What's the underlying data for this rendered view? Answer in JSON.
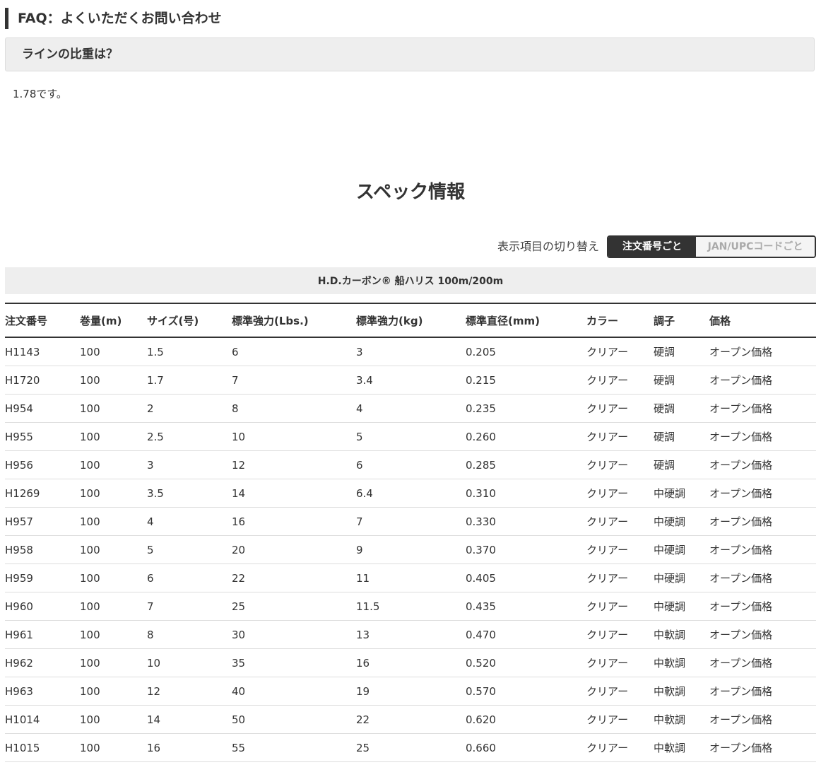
{
  "faq": {
    "heading": "FAQ：よくいただくお問い合わせ",
    "question": "ラインの比重は？",
    "answer": "1.78です。"
  },
  "spec": {
    "title": "スペック情報",
    "toggle_label": "表示項目の切り替え",
    "toggle_options": [
      "注文番号ごと",
      "JAN/UPCコードごと"
    ],
    "toggle_selected": "注文番号ごと",
    "product_name": "H.D.カーボン® 船ハリス 100m/200m",
    "columns": [
      "注文番号",
      "巻量(m)",
      "サイズ(号)",
      "標準強力(Lbs.)",
      "標準強力(kg)",
      "標準直径(mm)",
      "カラー",
      "調子",
      "価格"
    ],
    "rows": [
      [
        "H1143",
        "100",
        "1.5",
        "6",
        "3",
        "0.205",
        "クリアー",
        "硬調",
        "オープン価格"
      ],
      [
        "H1720",
        "100",
        "1.7",
        "7",
        "3.4",
        "0.215",
        "クリアー",
        "硬調",
        "オープン価格"
      ],
      [
        "H954",
        "100",
        "2",
        "8",
        "4",
        "0.235",
        "クリアー",
        "硬調",
        "オープン価格"
      ],
      [
        "H955",
        "100",
        "2.5",
        "10",
        "5",
        "0.260",
        "クリアー",
        "硬調",
        "オープン価格"
      ],
      [
        "H956",
        "100",
        "3",
        "12",
        "6",
        "0.285",
        "クリアー",
        "硬調",
        "オープン価格"
      ],
      [
        "H1269",
        "100",
        "3.5",
        "14",
        "6.4",
        "0.310",
        "クリアー",
        "中硬調",
        "オープン価格"
      ],
      [
        "H957",
        "100",
        "4",
        "16",
        "7",
        "0.330",
        "クリアー",
        "中硬調",
        "オープン価格"
      ],
      [
        "H958",
        "100",
        "5",
        "20",
        "9",
        "0.370",
        "クリアー",
        "中硬調",
        "オープン価格"
      ],
      [
        "H959",
        "100",
        "6",
        "22",
        "11",
        "0.405",
        "クリアー",
        "中硬調",
        "オープン価格"
      ],
      [
        "H960",
        "100",
        "7",
        "25",
        "11.5",
        "0.435",
        "クリアー",
        "中硬調",
        "オープン価格"
      ],
      [
        "H961",
        "100",
        "8",
        "30",
        "13",
        "0.470",
        "クリアー",
        "中軟調",
        "オープン価格"
      ],
      [
        "H962",
        "100",
        "10",
        "35",
        "16",
        "0.520",
        "クリアー",
        "中軟調",
        "オープン価格"
      ],
      [
        "H963",
        "100",
        "12",
        "40",
        "19",
        "0.570",
        "クリアー",
        "中軟調",
        "オープン価格"
      ],
      [
        "H1014",
        "100",
        "14",
        "50",
        "22",
        "0.620",
        "クリアー",
        "中軟調",
        "オープン価格"
      ],
      [
        "H1015",
        "100",
        "16",
        "55",
        "25",
        "0.660",
        "クリアー",
        "中軟調",
        "オープン価格"
      ]
    ]
  }
}
